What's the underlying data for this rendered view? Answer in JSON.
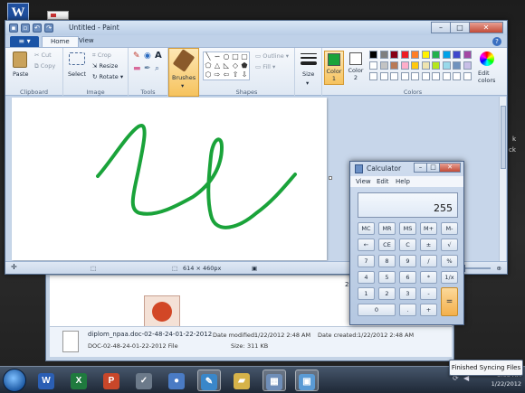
{
  "desktop": {
    "word_icon_letter": "W",
    "right_edge_text": [
      "k",
      "ck"
    ]
  },
  "explorer": {
    "partial_number": "20",
    "file_name": "diplom_npaa.doc-02-48-24-01-22-2012",
    "file_type": "DOC-02-48-24-01-22-2012 File",
    "date_modified_label": "Date modified:",
    "date_modified": "1/22/2012 2:48 AM",
    "date_created_label": "Date created:",
    "date_created": "1/22/2012 2:48 AM",
    "size_label": "Size:",
    "size": "311 KB"
  },
  "paint": {
    "title": "Untitled - Paint",
    "tabs": [
      {
        "label": "Home"
      },
      {
        "label": "View"
      }
    ],
    "help": "?",
    "clipboard": {
      "paste": "Paste",
      "cut": "Cut",
      "copy": "Copy",
      "label": "Clipboard"
    },
    "image": {
      "select": "Select",
      "crop": "Crop",
      "resize": "Resize",
      "rotate": "Rotate ▾",
      "label": "Image"
    },
    "tools": {
      "label": "Tools",
      "text_tool": "A"
    },
    "brushes": {
      "label": "Brushes"
    },
    "shapes": {
      "outline": "Outline ▾",
      "fill": "Fill ▾",
      "label": "Shapes"
    },
    "size": {
      "label": "Size"
    },
    "colors": {
      "color1": "Color 1",
      "color2": "Color 2",
      "edit": "Edit colors",
      "label": "Colors",
      "color1_value": "#1aa33a",
      "color2_value": "#ffffff",
      "palette": [
        "#000000",
        "#7f7f7f",
        "#880015",
        "#ed1c24",
        "#ff7f27",
        "#fff200",
        "#22b14c",
        "#00a2e8",
        "#3f48cc",
        "#a349a4",
        "#ffffff",
        "#c3c3c3",
        "#b97a57",
        "#ffaec9",
        "#ffc90e",
        "#efe4b0",
        "#b5e61d",
        "#99d9ea",
        "#7092be",
        "#c8bfe7",
        "#ffffff",
        "#ffffff",
        "#ffffff",
        "#ffffff",
        "#ffffff",
        "#ffffff",
        "#ffffff",
        "#ffffff",
        "#ffffff",
        "#ffffff"
      ]
    },
    "stroke_color": "#1aa33a",
    "status": {
      "dimensions": "614 × 460px"
    }
  },
  "calculator": {
    "title": "Calculator",
    "menu": [
      "View",
      "Edit",
      "Help"
    ],
    "display": "255",
    "keys": [
      [
        "MC",
        "MR",
        "MS",
        "M+",
        "M-"
      ],
      [
        "←",
        "CE",
        "C",
        "±",
        "√"
      ],
      [
        "7",
        "8",
        "9",
        "/",
        "%"
      ],
      [
        "4",
        "5",
        "6",
        "*",
        "1/x"
      ],
      [
        "1",
        "2",
        "3",
        "-"
      ],
      [
        "0",
        ".",
        "+"
      ]
    ],
    "equals": "="
  },
  "taskbar": {
    "apps": [
      {
        "name": "word",
        "glyph": "W",
        "color": "#2b5fb4"
      },
      {
        "name": "excel",
        "glyph": "X",
        "color": "#1f7a3e"
      },
      {
        "name": "powerpoint",
        "glyph": "P",
        "color": "#c8472a"
      },
      {
        "name": "checklist",
        "glyph": "✓",
        "color": "#6c7a8a"
      },
      {
        "name": "media",
        "glyph": "●",
        "color": "#4a7bc4"
      },
      {
        "name": "paint",
        "glyph": "✎",
        "color": "#3a87c9"
      },
      {
        "name": "folder",
        "glyph": "▰",
        "color": "#d6b34a"
      },
      {
        "name": "calculator",
        "glyph": "▦",
        "color": "#6f8eb8"
      },
      {
        "name": "explorer",
        "glyph": "▣",
        "color": "#5b9bd5"
      }
    ],
    "time": "3:08 AM",
    "date": "1/22/2012",
    "notification": "Finished Syncing Files"
  }
}
